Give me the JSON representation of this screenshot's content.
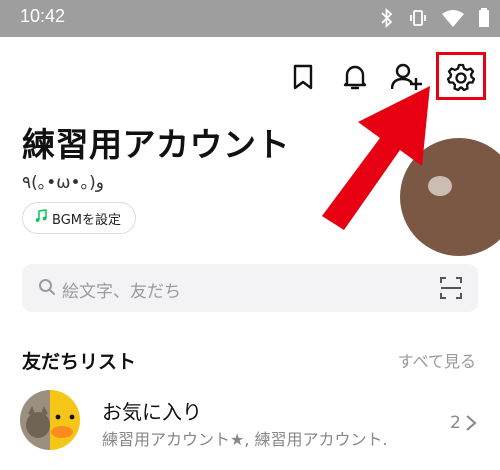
{
  "status_bar": {
    "time": "10:42"
  },
  "header": {
    "icons": [
      "bookmark-icon",
      "bell-icon",
      "add-friend-icon",
      "gear-icon"
    ]
  },
  "profile": {
    "name": "練習用アカウント",
    "status_message": "٩(｡•ω•｡)و",
    "bgm_label": "BGMを設定"
  },
  "search": {
    "placeholder": "絵文字、友だち"
  },
  "friends": {
    "title": "友だちリスト",
    "see_all": "すべて見る",
    "favorites": {
      "title": "お気に入り",
      "members": "練習用アカウント★, 練習用アカウント.",
      "count": "2"
    }
  },
  "colors": {
    "status_bar": "#9e9e9e",
    "highlight": "#e60012",
    "arrow": "#e60012",
    "bgm_note": "#06c755",
    "avatar": "#7a5843"
  }
}
